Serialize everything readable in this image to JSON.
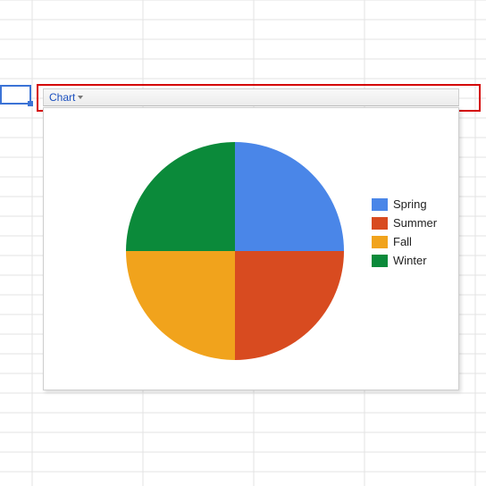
{
  "toolbar": {
    "label": "Chart"
  },
  "legend": {
    "items": [
      {
        "label": "Spring",
        "color": "#4a86e8"
      },
      {
        "label": "Summer",
        "color": "#d84b20"
      },
      {
        "label": "Fall",
        "color": "#f1a31c"
      },
      {
        "label": "Winter",
        "color": "#0b8a3a"
      }
    ]
  },
  "chart_data": {
    "type": "pie",
    "title": "",
    "categories": [
      "Spring",
      "Summer",
      "Fall",
      "Winter"
    ],
    "values": [
      25,
      25,
      25,
      25
    ],
    "colors": [
      "#4a86e8",
      "#d84b20",
      "#f1a31c",
      "#0b8a3a"
    ]
  }
}
